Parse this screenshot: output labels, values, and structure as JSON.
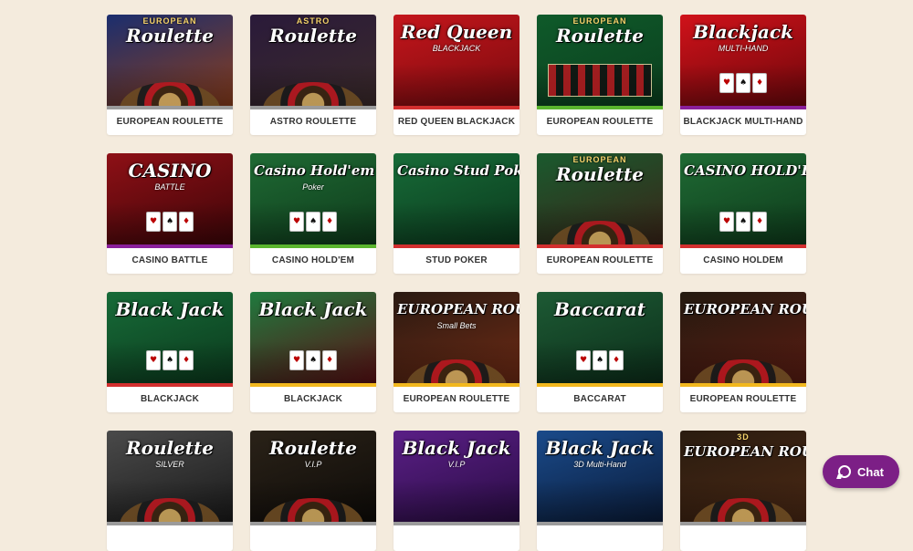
{
  "games": [
    {
      "label": "EUROPEAN ROULETTE",
      "thumb_title": "Roulette",
      "thumb_sub": "EUROPEAN",
      "thumb_sub2": "",
      "bg1": "#1b2e6e",
      "bg2": "#8a3d1c",
      "bar": "#9b9b9b",
      "motif": "wheel"
    },
    {
      "label": "ASTRO ROULETTE",
      "thumb_title": "Roulette",
      "thumb_sub": "ASTRO",
      "thumb_sub2": "",
      "bg1": "#2a1a3a",
      "bg2": "#3b2a2a",
      "bar": "#9b9b9b",
      "motif": "wheel"
    },
    {
      "label": "RED QUEEN BLACKJACK",
      "thumb_title": "Red Queen",
      "thumb_sub": "",
      "thumb_sub2": "BLACKJACK",
      "bg1": "#c4161c",
      "bg2": "#7a0a0e",
      "bar": "#d32f2f",
      "motif": "none"
    },
    {
      "label": "EUROPEAN ROULETTE",
      "thumb_title": "Roulette",
      "thumb_sub": "EUROPEAN",
      "thumb_sub2": "",
      "bg1": "#0f5a2a",
      "bg2": "#0b3f1e",
      "bar": "#5ab52e",
      "motif": "table"
    },
    {
      "label": "BLACKJACK MULTI-HAND",
      "thumb_title": "Blackjack",
      "thumb_sub": "",
      "thumb_sub2": "MULTI-HAND",
      "bg1": "#d0121a",
      "bg2": "#6e070b",
      "bar": "#8a1f9a",
      "motif": "cards"
    },
    {
      "label": "CASINO BATTLE",
      "thumb_title": "CASINO",
      "thumb_sub": "",
      "thumb_sub2": "BATTLE",
      "bg1": "#8e1016",
      "bg2": "#3e0508",
      "bar": "#8a1f9a",
      "motif": "cards"
    },
    {
      "label": "CASINO HOLD'EM",
      "thumb_title": "Casino Hold'em",
      "thumb_sub": "",
      "thumb_sub2": "Poker",
      "bg1": "#1f6a34",
      "bg2": "#0e3b1b",
      "bar": "#5ab52e",
      "motif": "cards"
    },
    {
      "label": "STUD POKER",
      "thumb_title": "Casino Stud Poker",
      "thumb_sub": "",
      "thumb_sub2": "",
      "bg1": "#176b38",
      "bg2": "#0b3a1d",
      "bar": "#d32f2f",
      "motif": "none"
    },
    {
      "label": "EUROPEAN ROULETTE",
      "thumb_title": "Roulette",
      "thumb_sub": "EUROPEAN",
      "thumb_sub2": "",
      "bg1": "#1a5a2e",
      "bg2": "#3a2418",
      "bar": "#d32f2f",
      "motif": "wheel"
    },
    {
      "label": "CASINO HOLDEM",
      "thumb_title": "CASINO HOLD'EM",
      "thumb_sub": "",
      "thumb_sub2": "",
      "bg1": "#1f6a34",
      "bg2": "#0e3b1b",
      "bar": "#d32f2f",
      "motif": "cards"
    },
    {
      "label": "BLACKJACK",
      "thumb_title": "Black Jack",
      "thumb_sub": "",
      "thumb_sub2": "",
      "bg1": "#176b38",
      "bg2": "#0b3a1d",
      "bar": "#d32f2f",
      "motif": "cards"
    },
    {
      "label": "BLACKJACK",
      "thumb_title": "Black Jack",
      "thumb_sub": "",
      "thumb_sub2": "",
      "bg1": "#1f7a3e",
      "bg2": "#5a0f14",
      "bar": "#f2b81e",
      "motif": "cards"
    },
    {
      "label": "EUROPEAN ROULETTE",
      "thumb_title": "EUROPEAN ROULETTE",
      "thumb_sub": "",
      "thumb_sub2": "Small Bets",
      "bg1": "#2a1a12",
      "bg2": "#6e2a14",
      "bar": "#f2b81e",
      "motif": "wheel"
    },
    {
      "label": "BACCARAT",
      "thumb_title": "Baccarat",
      "thumb_sub": "",
      "thumb_sub2": "",
      "bg1": "#1d5a34",
      "bg2": "#0c2e1a",
      "bar": "#f2b81e",
      "motif": "cards"
    },
    {
      "label": "EUROPEAN ROULETTE",
      "thumb_title": "EUROPEAN ROULETTE",
      "thumb_sub": "",
      "thumb_sub2": "",
      "bg1": "#241a10",
      "bg2": "#5a1c12",
      "bar": "#f2b81e",
      "motif": "wheel"
    },
    {
      "label": "",
      "thumb_title": "Roulette",
      "thumb_sub": "",
      "thumb_sub2": "SILVER",
      "bg1": "#4a4a4a",
      "bg2": "#1a1a1a",
      "bar": "#9b9b9b",
      "motif": "wheel"
    },
    {
      "label": "",
      "thumb_title": "Roulette",
      "thumb_sub": "",
      "thumb_sub2": "V.I.P",
      "bg1": "#2a2218",
      "bg2": "#0e0b08",
      "bar": "#9b9b9b",
      "motif": "wheel"
    },
    {
      "label": "",
      "thumb_title": "Black Jack",
      "thumb_sub": "",
      "thumb_sub2": "V.I.P",
      "bg1": "#5a1f86",
      "bg2": "#2a0c44",
      "bar": "#9b9b9b",
      "motif": "none"
    },
    {
      "label": "",
      "thumb_title": "Black Jack",
      "thumb_sub": "",
      "thumb_sub2": "3D Multi-Hand",
      "bg1": "#1a4a8a",
      "bg2": "#0a1c3a",
      "bar": "#9b9b9b",
      "motif": "none"
    },
    {
      "label": "",
      "thumb_title": "EUROPEAN ROULETTE",
      "thumb_sub": "3D",
      "thumb_sub2": "",
      "bg1": "#2a1c10",
      "bg2": "#4a2814",
      "bar": "#9b9b9b",
      "motif": "wheel"
    }
  ],
  "chat": {
    "label": "Chat"
  }
}
